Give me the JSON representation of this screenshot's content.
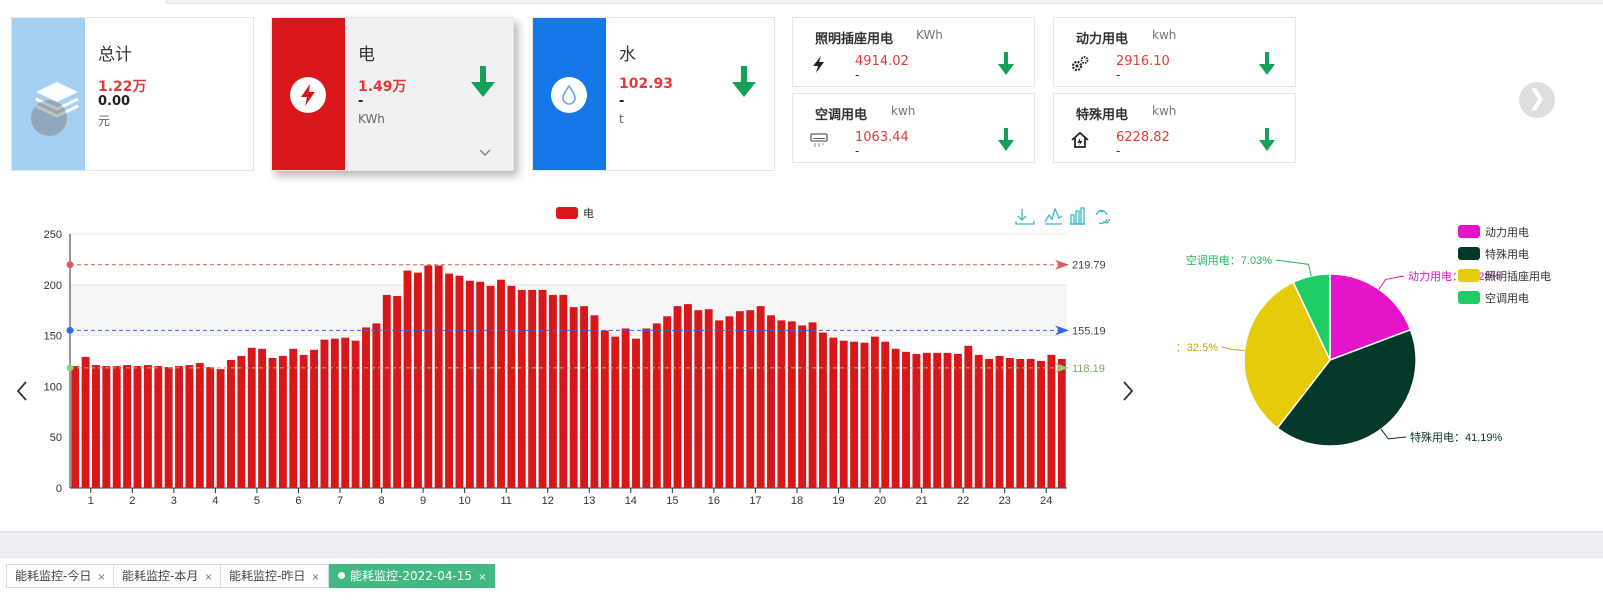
{
  "cards": {
    "total": {
      "title": "总计",
      "value_primary": "1.22万",
      "value_secondary": "0.00",
      "unit": "元"
    },
    "electricity": {
      "title": "电",
      "value_primary": "1.49万",
      "value_secondary": "-",
      "unit": "KWh"
    },
    "water": {
      "title": "水",
      "value_primary": "102.93",
      "value_secondary": "-",
      "unit": "t"
    }
  },
  "sub_cards": {
    "lighting": {
      "title": "照明插座用电",
      "unit": "KWh",
      "value": "4914.02",
      "change": "-"
    },
    "power": {
      "title": "动力用电",
      "unit": "kwh",
      "value": "2916.10",
      "change": "-"
    },
    "ac": {
      "title": "空调用电",
      "unit": "kwh",
      "value": "1063.44",
      "change": "-"
    },
    "special": {
      "title": "特殊用电",
      "unit": "kwh",
      "value": "6228.82",
      "change": "-"
    }
  },
  "colors": {
    "electricity": "#d7171a",
    "water": "#1677e8",
    "total": "#a6d0f1",
    "down_arrow": "#12a156",
    "value_red": "#e23a3a",
    "toolbox": "#3cb8c9"
  },
  "icons": {
    "total": "layers-icon",
    "electricity": "lightning-icon",
    "water": "water-drop-icon",
    "lighting": "lightning-icon",
    "power": "gears-icon",
    "ac": "air-conditioner-icon",
    "special": "house-icon",
    "trend": "arrow-down-icon"
  },
  "chart_data": [
    {
      "type": "bar",
      "legend": [
        "电"
      ],
      "legend_position": "top-center",
      "x_ticks": [
        "1",
        "2",
        "3",
        "4",
        "5",
        "6",
        "7",
        "8",
        "9",
        "10",
        "11",
        "12",
        "13",
        "14",
        "15",
        "16",
        "17",
        "18",
        "19",
        "20",
        "21",
        "22",
        "23",
        "24"
      ],
      "bars_per_hour": 4,
      "series": [
        {
          "name": "电",
          "color": "#d7171a",
          "values": [
            120,
            129,
            121,
            120,
            120,
            121,
            120,
            121,
            120,
            119,
            120,
            121,
            123,
            119,
            117,
            126,
            130,
            138,
            137,
            128,
            130,
            137,
            131,
            136,
            146,
            147,
            148,
            145,
            158,
            162,
            190,
            189,
            214,
            212,
            219,
            219,
            211,
            209,
            204,
            203,
            199,
            205,
            199,
            195,
            195,
            195,
            190,
            190,
            178,
            179,
            170,
            155,
            149,
            157,
            147,
            157,
            162,
            169,
            179,
            181,
            175,
            176,
            165,
            169,
            174,
            175,
            179,
            170,
            165,
            164,
            160,
            163,
            153,
            148,
            145,
            144,
            143,
            149,
            144,
            137,
            134,
            132,
            133,
            133,
            133,
            132,
            140,
            131,
            127,
            130,
            128,
            127,
            127,
            125,
            131,
            127
          ]
        }
      ],
      "ylim": [
        0,
        250
      ],
      "y_ticks": [
        0,
        50,
        100,
        150,
        200,
        250
      ],
      "grid": true,
      "mark_lines": [
        {
          "label": "219.79",
          "value": 219.79,
          "color": "#e45656"
        },
        {
          "label": "155.19",
          "value": 155.19,
          "color": "#3366ee"
        },
        {
          "label": "118.19",
          "value": 118.19,
          "color": "#91cc75"
        }
      ]
    },
    {
      "type": "pie",
      "legend": [
        "动力用电",
        "特殊用电",
        "照明插座用电",
        "空调用电"
      ],
      "legend_position": "top-right",
      "slices": [
        {
          "name": "动力用电",
          "value": 19.28,
          "color": "#e414c8",
          "label": "动力用电：19.28%"
        },
        {
          "name": "特殊用电",
          "value": 41.19,
          "color": "#04382a",
          "label": "特殊用电：41.19%"
        },
        {
          "name": "照明插座用电",
          "value": 32.5,
          "color": "#e6cb0a",
          "label": "：32.5%"
        },
        {
          "name": "空调用电",
          "value": 7.03,
          "color": "#1fcc66",
          "label": "空调用电：7.03%"
        }
      ]
    }
  ],
  "tabs": [
    {
      "label": "能耗监控-今日",
      "active": false
    },
    {
      "label": "能耗监控-本月",
      "active": false
    },
    {
      "label": "能耗监控-昨日",
      "active": false
    },
    {
      "label": "能耗监控-2022-04-15",
      "active": true
    }
  ],
  "tab_close_glyph": "×"
}
